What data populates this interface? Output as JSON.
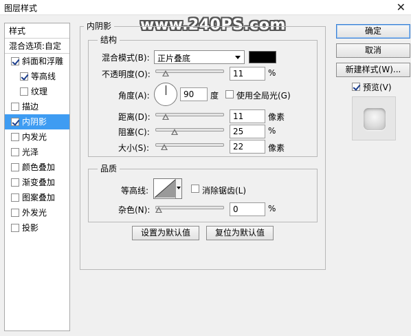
{
  "window": {
    "title": "图层样式",
    "close_glyph": "✕"
  },
  "watermark": "www.240PS.com",
  "sidebar": {
    "header": "样式",
    "blend_options": "混合选项:自定",
    "items": [
      {
        "label": "斜面和浮雕",
        "checked": true,
        "indent": false,
        "selected": false
      },
      {
        "label": "等高线",
        "checked": true,
        "indent": true,
        "selected": false
      },
      {
        "label": "纹理",
        "checked": false,
        "indent": true,
        "selected": false
      },
      {
        "label": "描边",
        "checked": false,
        "indent": false,
        "selected": false
      },
      {
        "label": "内阴影",
        "checked": true,
        "indent": false,
        "selected": true
      },
      {
        "label": "内发光",
        "checked": false,
        "indent": false,
        "selected": false
      },
      {
        "label": "光泽",
        "checked": false,
        "indent": false,
        "selected": false
      },
      {
        "label": "颜色叠加",
        "checked": false,
        "indent": false,
        "selected": false
      },
      {
        "label": "渐变叠加",
        "checked": false,
        "indent": false,
        "selected": false
      },
      {
        "label": "图案叠加",
        "checked": false,
        "indent": false,
        "selected": false
      },
      {
        "label": "外发光",
        "checked": false,
        "indent": false,
        "selected": false
      },
      {
        "label": "投影",
        "checked": false,
        "indent": false,
        "selected": false
      }
    ]
  },
  "inner_shadow": {
    "title": "内阴影",
    "structure": {
      "title": "结构",
      "blend_mode_label": "混合模式(B):",
      "blend_mode_value": "正片叠底",
      "shadow_color": "#000000",
      "opacity_label": "不透明度(O):",
      "opacity_value": "11",
      "opacity_unit": "%",
      "angle_label": "角度(A):",
      "angle_value": "90",
      "angle_unit": "度",
      "global_light_label": "使用全局光(G)",
      "global_light_checked": false,
      "distance_label": "距离(D):",
      "distance_value": "11",
      "distance_unit": "像素",
      "choke_label": "阻塞(C):",
      "choke_value": "25",
      "choke_unit": "%",
      "size_label": "大小(S):",
      "size_value": "22",
      "size_unit": "像素"
    },
    "quality": {
      "title": "品质",
      "contour_label": "等高线:",
      "anti_alias_label": "消除锯齿(L)",
      "anti_alias_checked": false,
      "noise_label": "杂色(N):",
      "noise_value": "0",
      "noise_unit": "%"
    },
    "make_default": "设置为默认值",
    "reset_default": "复位为默认值"
  },
  "actions": {
    "ok": "确定",
    "cancel": "取消",
    "new_style": "新建样式(W)...",
    "preview_label": "预览(V)",
    "preview_checked": true
  },
  "colors": {
    "selection": "#3e9cf2",
    "panel_bg": "#f0f0f0"
  }
}
